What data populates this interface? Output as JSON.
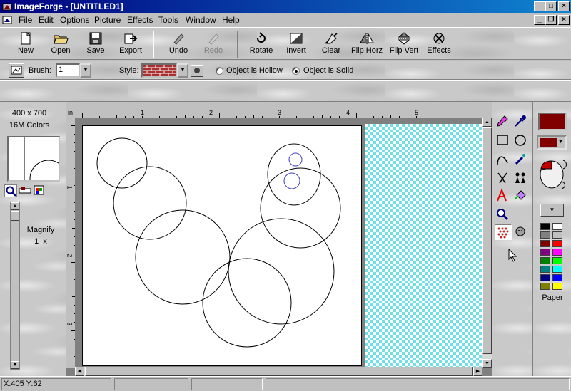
{
  "window": {
    "title": "ImageForge - [UNTITLED1]",
    "controls": [
      "_",
      "□",
      "×"
    ],
    "mdi_controls": [
      "_",
      "❐",
      "×"
    ]
  },
  "menu": [
    "File",
    "Edit",
    "Options",
    "Picture",
    "Effects",
    "Tools",
    "Window",
    "Help"
  ],
  "toolbar": {
    "new": "New",
    "open": "Open",
    "save": "Save",
    "export": "Export",
    "undo": "Undo",
    "redo": "Redo",
    "rotate": "Rotate",
    "invert": "Invert",
    "clear": "Clear",
    "flip_horz": "Flip Horz",
    "flip_vert": "Flip Vert",
    "effects": "Effects"
  },
  "options": {
    "brush_label": "Brush:",
    "brush_value": "1",
    "style_label": "Style:",
    "hollow_label": "Object is Hollow",
    "solid_label": "Object is Solid",
    "selected": "solid"
  },
  "info": {
    "size": "400 x 700",
    "colors": "16M Colors"
  },
  "magnify": {
    "label": "Magnify",
    "value": "1  x"
  },
  "ruler": {
    "unit": "in",
    "top_numbers": [
      "1",
      "2",
      "3",
      "4",
      "5"
    ],
    "left_numbers": [
      "1",
      "2",
      "3"
    ]
  },
  "colors": {
    "foreground": "#800000",
    "secondary": "#800000",
    "paper_label": "Paper",
    "palette": [
      "#000000",
      "#ffffff",
      "#808080",
      "#c0c0c0",
      "#800000",
      "#ff0000",
      "#800080",
      "#ff00ff",
      "#008000",
      "#00ff00",
      "#008080",
      "#00ffff",
      "#000080",
      "#0000ff",
      "#808000",
      "#ffff00"
    ]
  },
  "status": {
    "coords": "X:405 Y:62"
  }
}
